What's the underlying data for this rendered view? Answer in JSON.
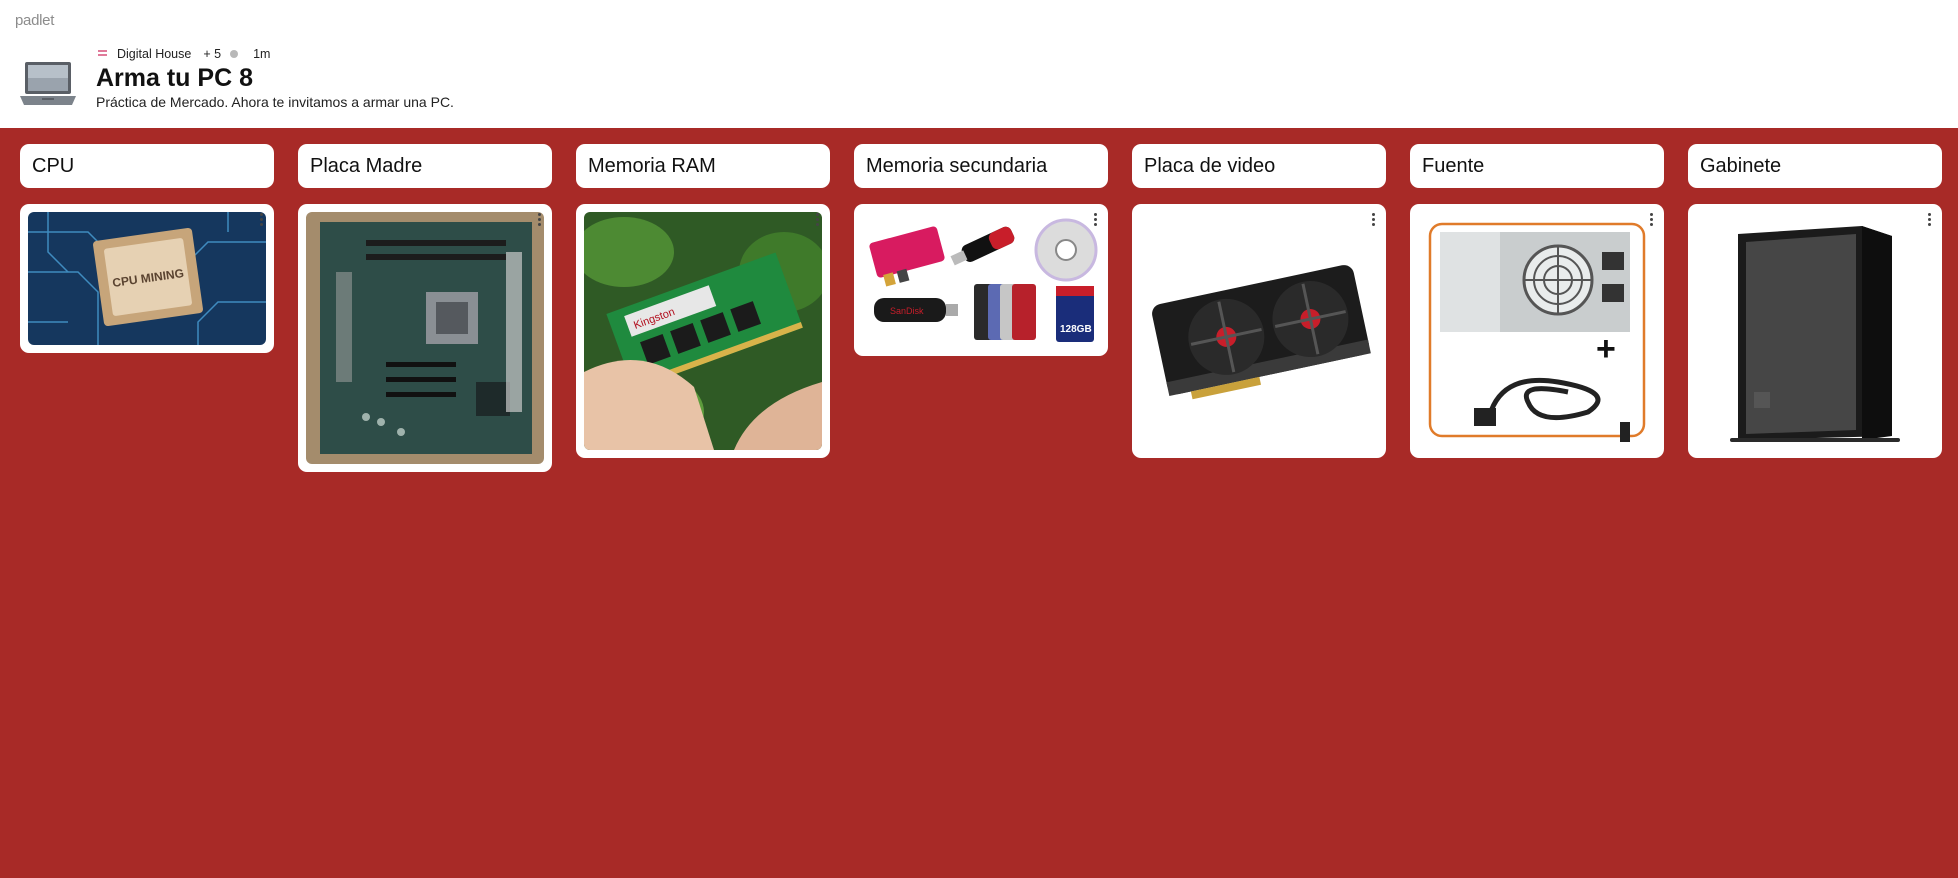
{
  "app": {
    "brand": "padlet"
  },
  "board": {
    "icon": "laptop-icon",
    "team": "Digital House",
    "contributors": "+ 5",
    "time": "1m",
    "title": "Arma tu PC 8",
    "description": "Práctica de Mercado. Ahora te invitamos a armar una PC."
  },
  "colors": {
    "wall": "#a82a27",
    "card": "#ffffff",
    "accent_orange": "#e07b2a"
  },
  "columns": [
    {
      "title": "CPU",
      "post_image": "cpu-mining-chip-image",
      "image_text": "CPU MINING"
    },
    {
      "title": "Placa Madre",
      "post_image": "motherboard-image"
    },
    {
      "title": "Memoria RAM",
      "post_image": "ram-module-in-hand-image",
      "image_text": "Kingston"
    },
    {
      "title": "Memoria secundaria",
      "post_image": "storage-devices-image",
      "image_text_a": "SanDisk",
      "image_text_b": "128GB"
    },
    {
      "title": "Placa de video",
      "post_image": "graphics-card-image"
    },
    {
      "title": "Fuente",
      "post_image": "power-supply-image",
      "image_text": "+"
    },
    {
      "title": "Gabinete",
      "post_image": "pc-case-image"
    }
  ]
}
